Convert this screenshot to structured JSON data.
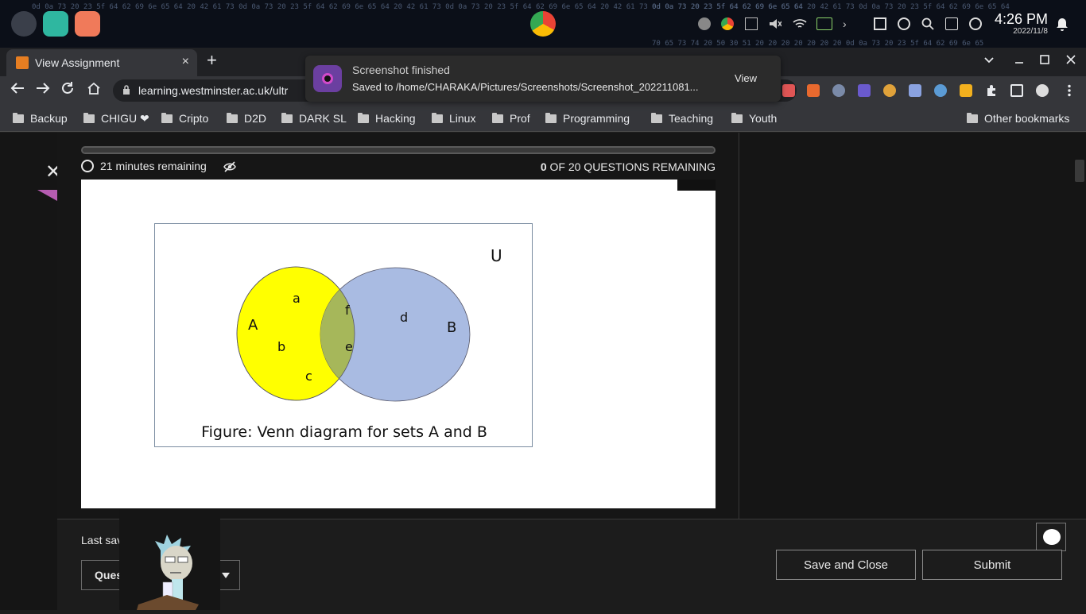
{
  "os": {
    "time": "4:26 PM",
    "date": "2022/11/8"
  },
  "browser": {
    "tab_title": "View Assignment",
    "tab_close": "×",
    "new_tab": "+",
    "url": "learning.westminster.ac.uk/ultr",
    "bookmarks": [
      "Backup",
      "CHIGU ❤",
      "Cripto",
      "D2D",
      "DARK SL",
      "Hacking",
      "Linux",
      "Prof",
      "Programming",
      "Teaching",
      "Youth"
    ],
    "other_bookmarks": "Other bookmarks"
  },
  "notification": {
    "title": "Screenshot finished",
    "message": "Saved to /home/CHARAKA/Pictures/Screenshots/Screenshot_202211081...",
    "action": "View"
  },
  "assessment": {
    "close_glyph": "✕",
    "progress_fraction": 1.0,
    "time_remaining": "21 minutes remaining",
    "questions_remaining_count": "0",
    "questions_remaining_text": "OF 20 QUESTIONS REMAINING",
    "last_saved": "Last sav",
    "question_select": "Ques",
    "save_close": "Save and Close",
    "submit": "Submit"
  },
  "venn": {
    "universe_label": "U",
    "set_a_label": "A",
    "set_b_label": "B",
    "only_a_elements": [
      "a",
      "b",
      "c"
    ],
    "intersection_elements": [
      "f",
      "e"
    ],
    "only_b_elements": [
      "d"
    ],
    "caption": "Figure: Venn diagram for sets A and B",
    "set_a_color": "#ffff00",
    "set_b_color": "#a9bbe2",
    "overlap_color": "#a6b75a"
  }
}
